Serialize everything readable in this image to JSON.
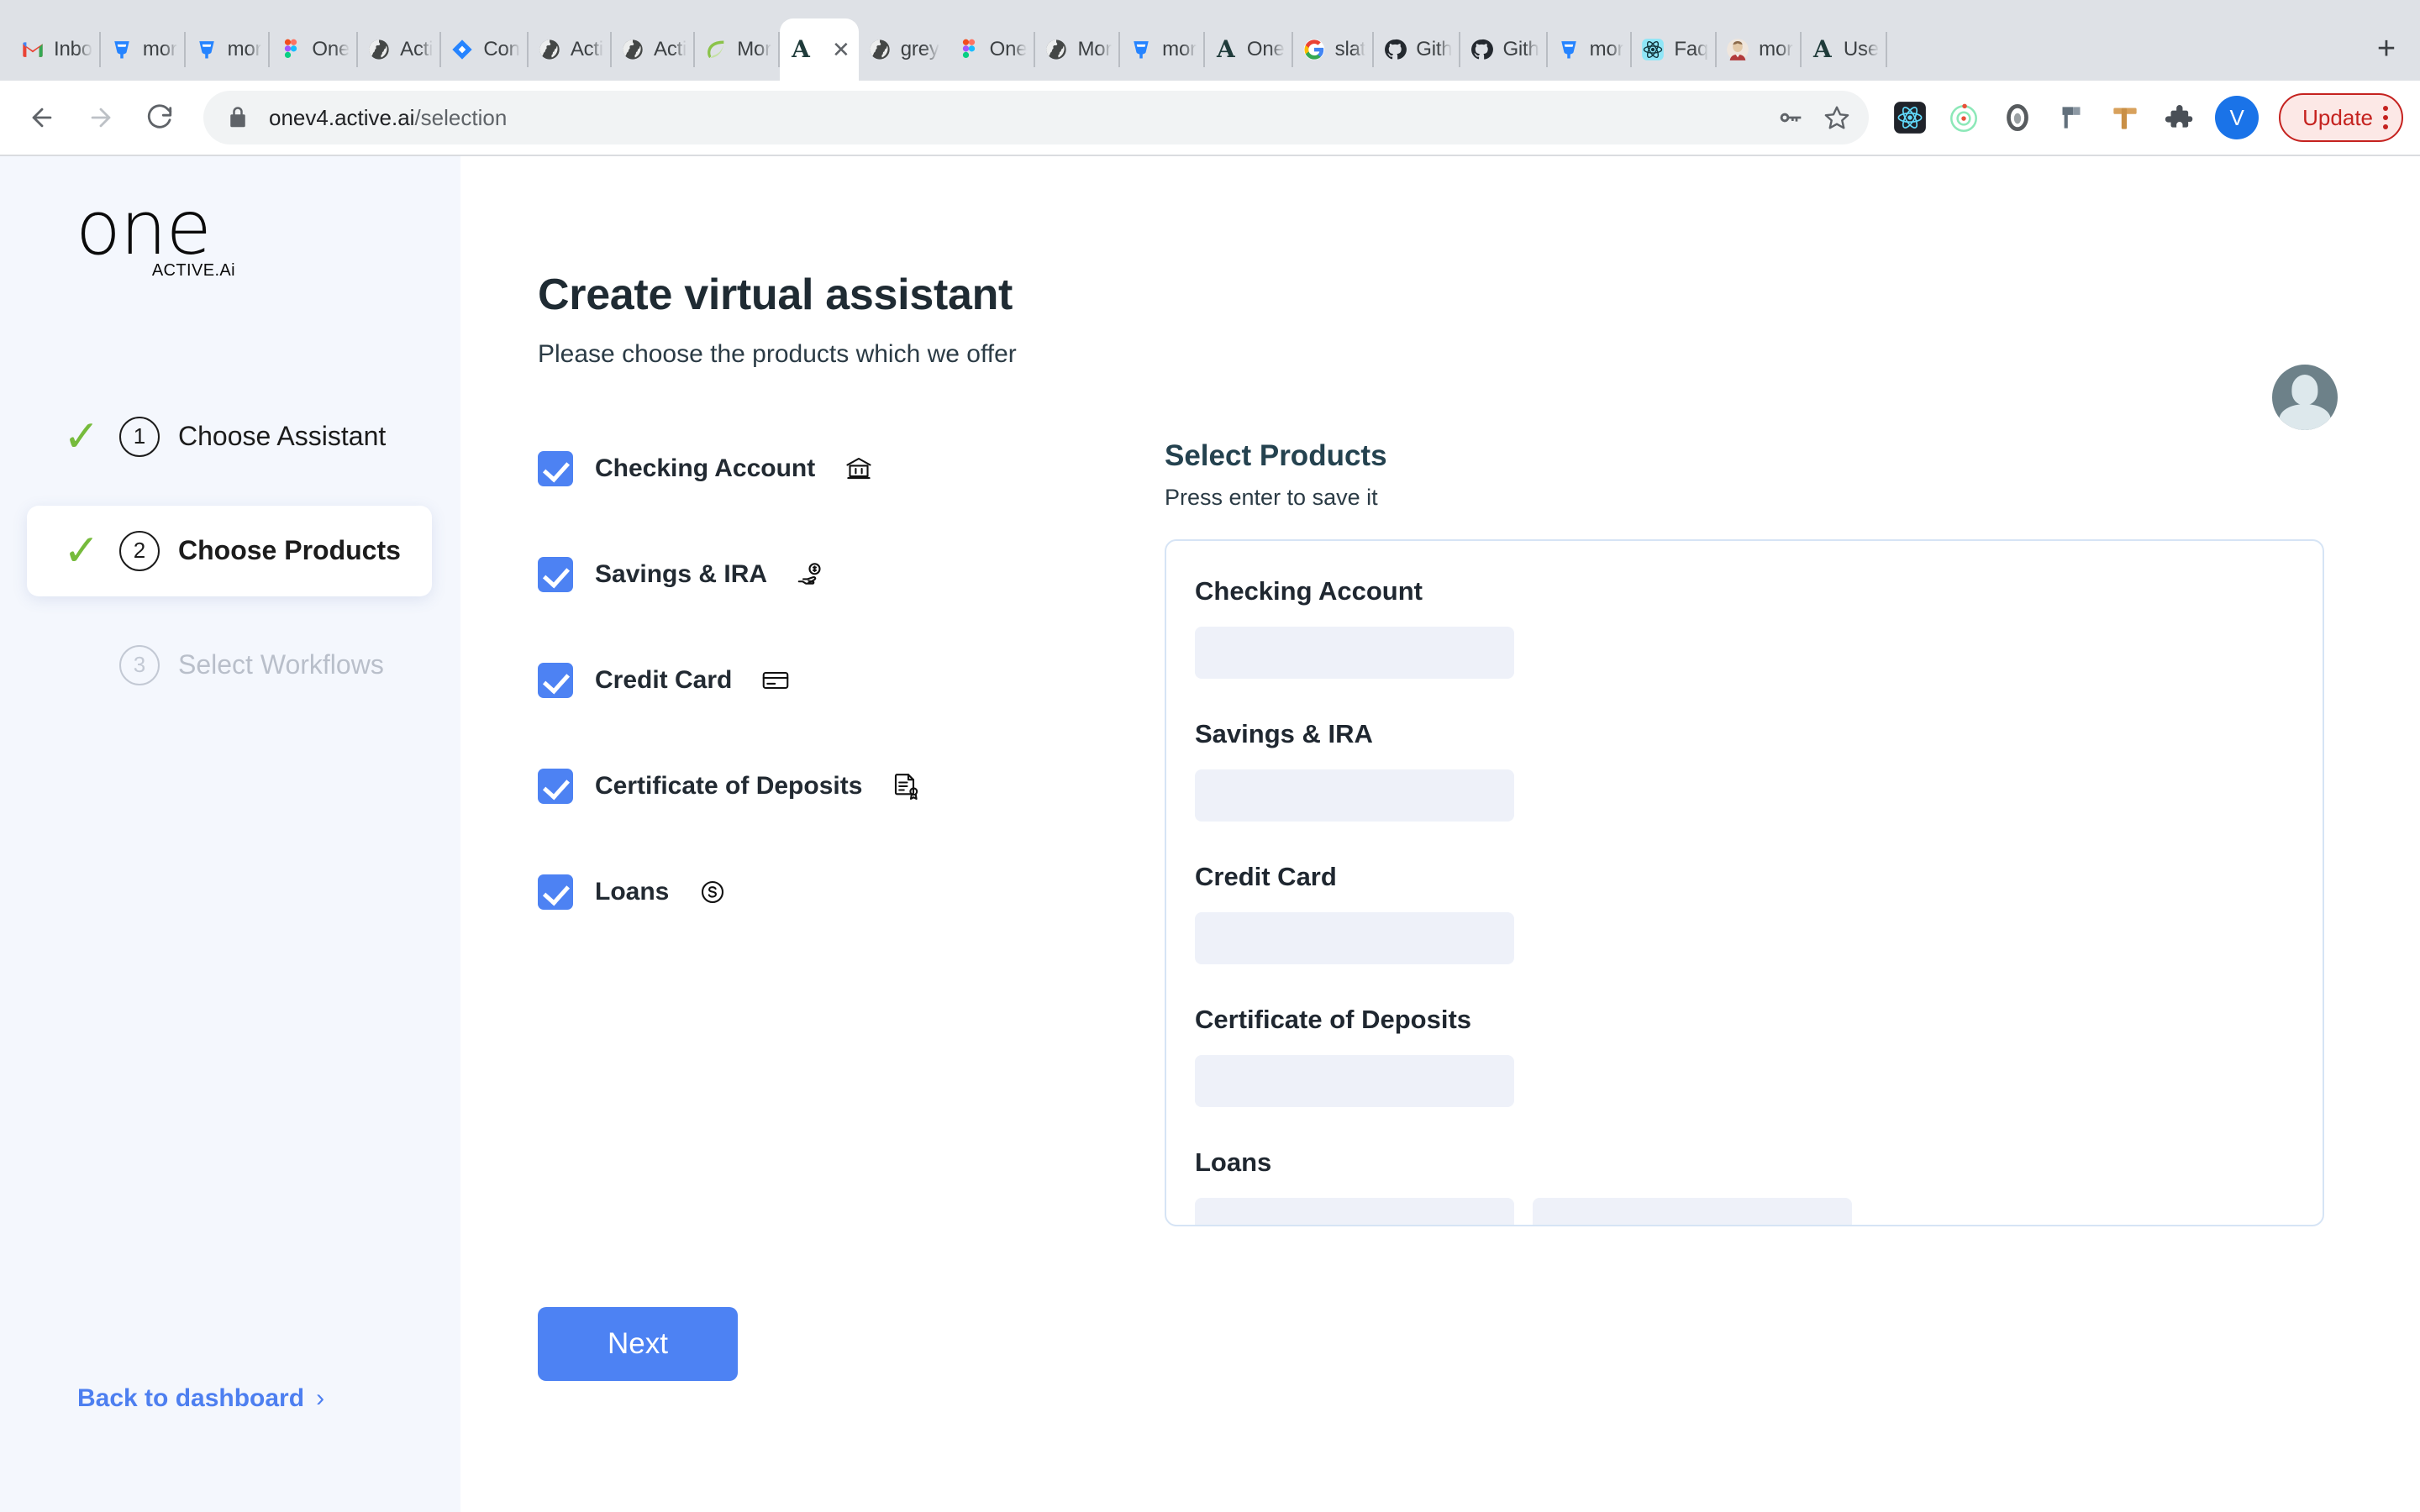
{
  "browser": {
    "tabs": [
      {
        "title": "Inbo",
        "icon": "gmail-icon",
        "active": false
      },
      {
        "title": "mor",
        "icon": "jira-icon",
        "active": false
      },
      {
        "title": "mor",
        "icon": "jira-icon",
        "active": false
      },
      {
        "title": "One",
        "icon": "figma-icon",
        "active": false
      },
      {
        "title": "Acti",
        "icon": "globe-icon",
        "active": false
      },
      {
        "title": "Con",
        "icon": "jira-diamond-icon",
        "active": false
      },
      {
        "title": "Acti",
        "icon": "globe-icon",
        "active": false
      },
      {
        "title": "Acti",
        "icon": "globe-icon",
        "active": false
      },
      {
        "title": "Mor",
        "icon": "leaf-icon",
        "active": false
      },
      {
        "title": "",
        "icon": "letter-a-icon",
        "active": true
      },
      {
        "title": "grey",
        "icon": "globe-icon",
        "active": false
      },
      {
        "title": "One",
        "icon": "figma-icon",
        "active": false
      },
      {
        "title": "Mor",
        "icon": "globe-icon",
        "active": false
      },
      {
        "title": "mor",
        "icon": "jira-icon",
        "active": false
      },
      {
        "title": "One",
        "icon": "letter-a-icon",
        "active": false
      },
      {
        "title": "slat",
        "icon": "google-icon",
        "active": false
      },
      {
        "title": "Gith",
        "icon": "github-icon",
        "active": false
      },
      {
        "title": "Gith",
        "icon": "github-icon",
        "active": false
      },
      {
        "title": "mor",
        "icon": "jira-icon",
        "active": false
      },
      {
        "title": "Faq",
        "icon": "react-icon",
        "active": false
      },
      {
        "title": "mor",
        "icon": "person-photo-icon",
        "active": false
      },
      {
        "title": "Use",
        "icon": "letter-a-icon",
        "active": false
      }
    ],
    "new_tab_label": "+",
    "close_tab_label": "✕",
    "url_host": "onev4.active.ai",
    "url_path": "/selection",
    "profile_initial": "V",
    "update_label": "Update",
    "extensions": [
      "react-icon",
      "orbit-icon",
      "ring-icon",
      "pin-icon",
      "ruler-icon",
      "puzzle-icon"
    ]
  },
  "sidebar": {
    "logo_word": "one",
    "logo_sub": "ACTIVE.Ai",
    "steps": [
      {
        "number": "1",
        "label": "Choose Assistant",
        "done": true,
        "current": false
      },
      {
        "number": "2",
        "label": "Choose Products",
        "done": true,
        "current": true
      },
      {
        "number": "3",
        "label": "Select Workflows",
        "done": false,
        "current": false
      }
    ],
    "back_link": "Back to dashboard",
    "back_chevron": "›"
  },
  "main": {
    "title": "Create virtual assistant",
    "subtitle": "Please choose the products which we offer",
    "next_label": "Next",
    "products": [
      {
        "label": "Checking Account",
        "icon": "bank-icon",
        "checked": true
      },
      {
        "label": "Savings & IRA",
        "icon": "hand-coin-icon",
        "checked": true
      },
      {
        "label": "Credit Card",
        "icon": "credit-card-icon",
        "checked": true
      },
      {
        "label": "Certificate of Deposits",
        "icon": "certificate-icon",
        "checked": true
      },
      {
        "label": "Loans",
        "icon": "dollar-circle-icon",
        "checked": true
      }
    ],
    "select_panel": {
      "title": "Select Products",
      "hint": "Press enter to save it",
      "fields": [
        {
          "label": "Checking Account",
          "value": ""
        },
        {
          "label": "Savings & IRA",
          "value": ""
        },
        {
          "label": "Credit Card",
          "value": ""
        },
        {
          "label": "Certificate of Deposits",
          "value": ""
        },
        {
          "label": "Loans",
          "value": ""
        }
      ]
    }
  },
  "colors": {
    "accent": "#4d82f3",
    "sidebar_bg": "#f4f7fd",
    "check_green": "#76bb3c",
    "panel_border": "#d6e4f5",
    "input_bg": "#eef1f9",
    "heading": "#1f2b33"
  }
}
